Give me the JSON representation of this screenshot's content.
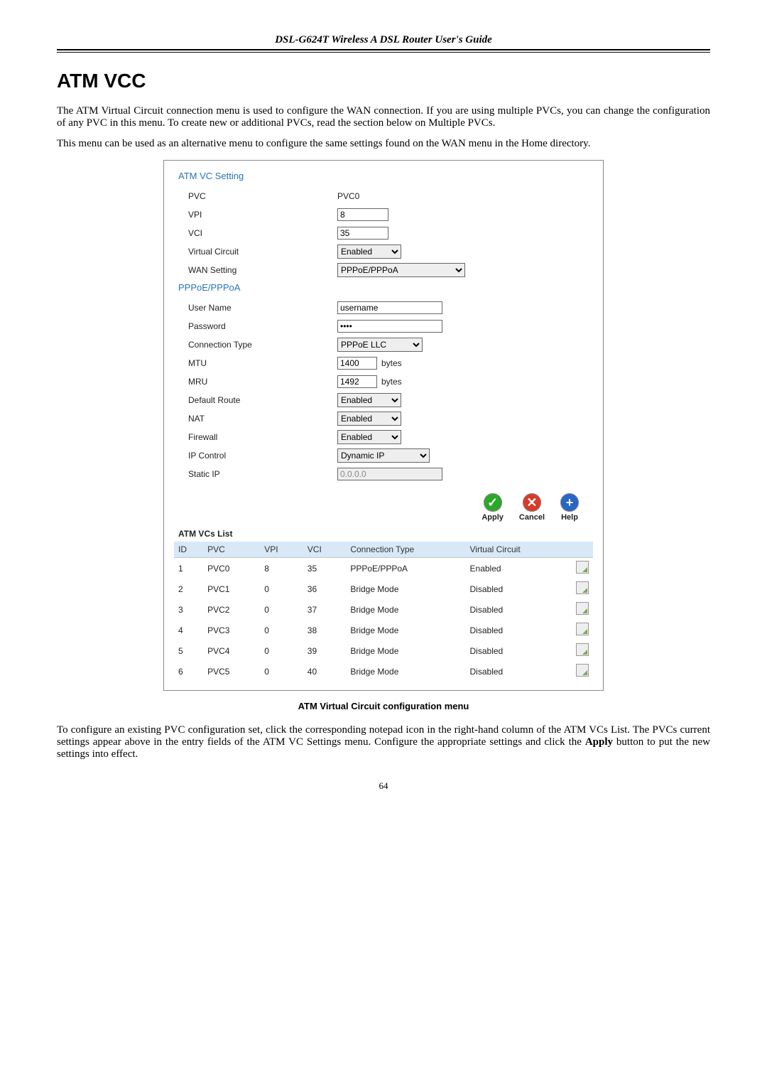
{
  "header": {
    "title": "DSL-G624T Wireless A DSL Router User's Guide"
  },
  "page_title": "ATM VCC",
  "intro_p1": "The ATM Virtual Circuit connection menu is used to configure the WAN connection. If you are using multiple PVCs, you can change the configuration of any PVC in this menu. To create new or additional PVCs, read the section below on Multiple PVCs.",
  "intro_p2": "This menu can be used as an alternative menu to configure the same settings found on the WAN menu in the Home directory.",
  "panel": {
    "section1_title": "ATM VC Setting",
    "pvc_lbl": "PVC",
    "pvc_val": "PVC0",
    "vpi_lbl": "VPI",
    "vpi_val": "8",
    "vci_lbl": "VCI",
    "vci_val": "35",
    "vcirc_lbl": "Virtual Circuit",
    "vcirc_val": "Enabled",
    "wan_lbl": "WAN Setting",
    "wan_val": "PPPoE/PPPoA",
    "section2_title": "PPPoE/PPPoA",
    "user_lbl": "User Name",
    "user_val": "username",
    "pass_lbl": "Password",
    "pass_val": "****",
    "ctype_lbl": "Connection Type",
    "ctype_val": "PPPoE LLC",
    "mtu_lbl": "MTU",
    "mtu_val": "1400",
    "mtu_unit": "bytes",
    "mru_lbl": "MRU",
    "mru_val": "1492",
    "mru_unit": "bytes",
    "droute_lbl": "Default Route",
    "droute_val": "Enabled",
    "nat_lbl": "NAT",
    "nat_val": "Enabled",
    "fw_lbl": "Firewall",
    "fw_val": "Enabled",
    "ipc_lbl": "IP Control",
    "ipc_val": "Dynamic IP",
    "sip_lbl": "Static IP",
    "sip_val": "0.0.0.0",
    "apply_lbl": "Apply",
    "cancel_lbl": "Cancel",
    "help_lbl": "Help",
    "list_title": "ATM VCs List",
    "cols": {
      "id": "ID",
      "pvc": "PVC",
      "vpi": "VPI",
      "vci": "VCI",
      "ct": "Connection Type",
      "vc": "Virtual Circuit"
    },
    "rows": [
      {
        "id": "1",
        "pvc": "PVC0",
        "vpi": "8",
        "vci": "35",
        "ct": "PPPoE/PPPoA",
        "vc": "Enabled"
      },
      {
        "id": "2",
        "pvc": "PVC1",
        "vpi": "0",
        "vci": "36",
        "ct": "Bridge Mode",
        "vc": "Disabled"
      },
      {
        "id": "3",
        "pvc": "PVC2",
        "vpi": "0",
        "vci": "37",
        "ct": "Bridge Mode",
        "vc": "Disabled"
      },
      {
        "id": "4",
        "pvc": "PVC3",
        "vpi": "0",
        "vci": "38",
        "ct": "Bridge Mode",
        "vc": "Disabled"
      },
      {
        "id": "5",
        "pvc": "PVC4",
        "vpi": "0",
        "vci": "39",
        "ct": "Bridge Mode",
        "vc": "Disabled"
      },
      {
        "id": "6",
        "pvc": "PVC5",
        "vpi": "0",
        "vci": "40",
        "ct": "Bridge Mode",
        "vc": "Disabled"
      }
    ]
  },
  "fig_caption": "ATM Virtual Circuit configuration menu",
  "outro_html_parts": {
    "a": "To configure an existing PVC configuration set, click the corresponding notepad icon in the right-hand column of the ATM VCs List. The PVCs current settings appear above in the entry fields of the ATM VC Settings menu. Configure the appropriate settings and click the ",
    "b": "Apply",
    "c": " button to put the new settings into effect."
  },
  "page_number": "64"
}
